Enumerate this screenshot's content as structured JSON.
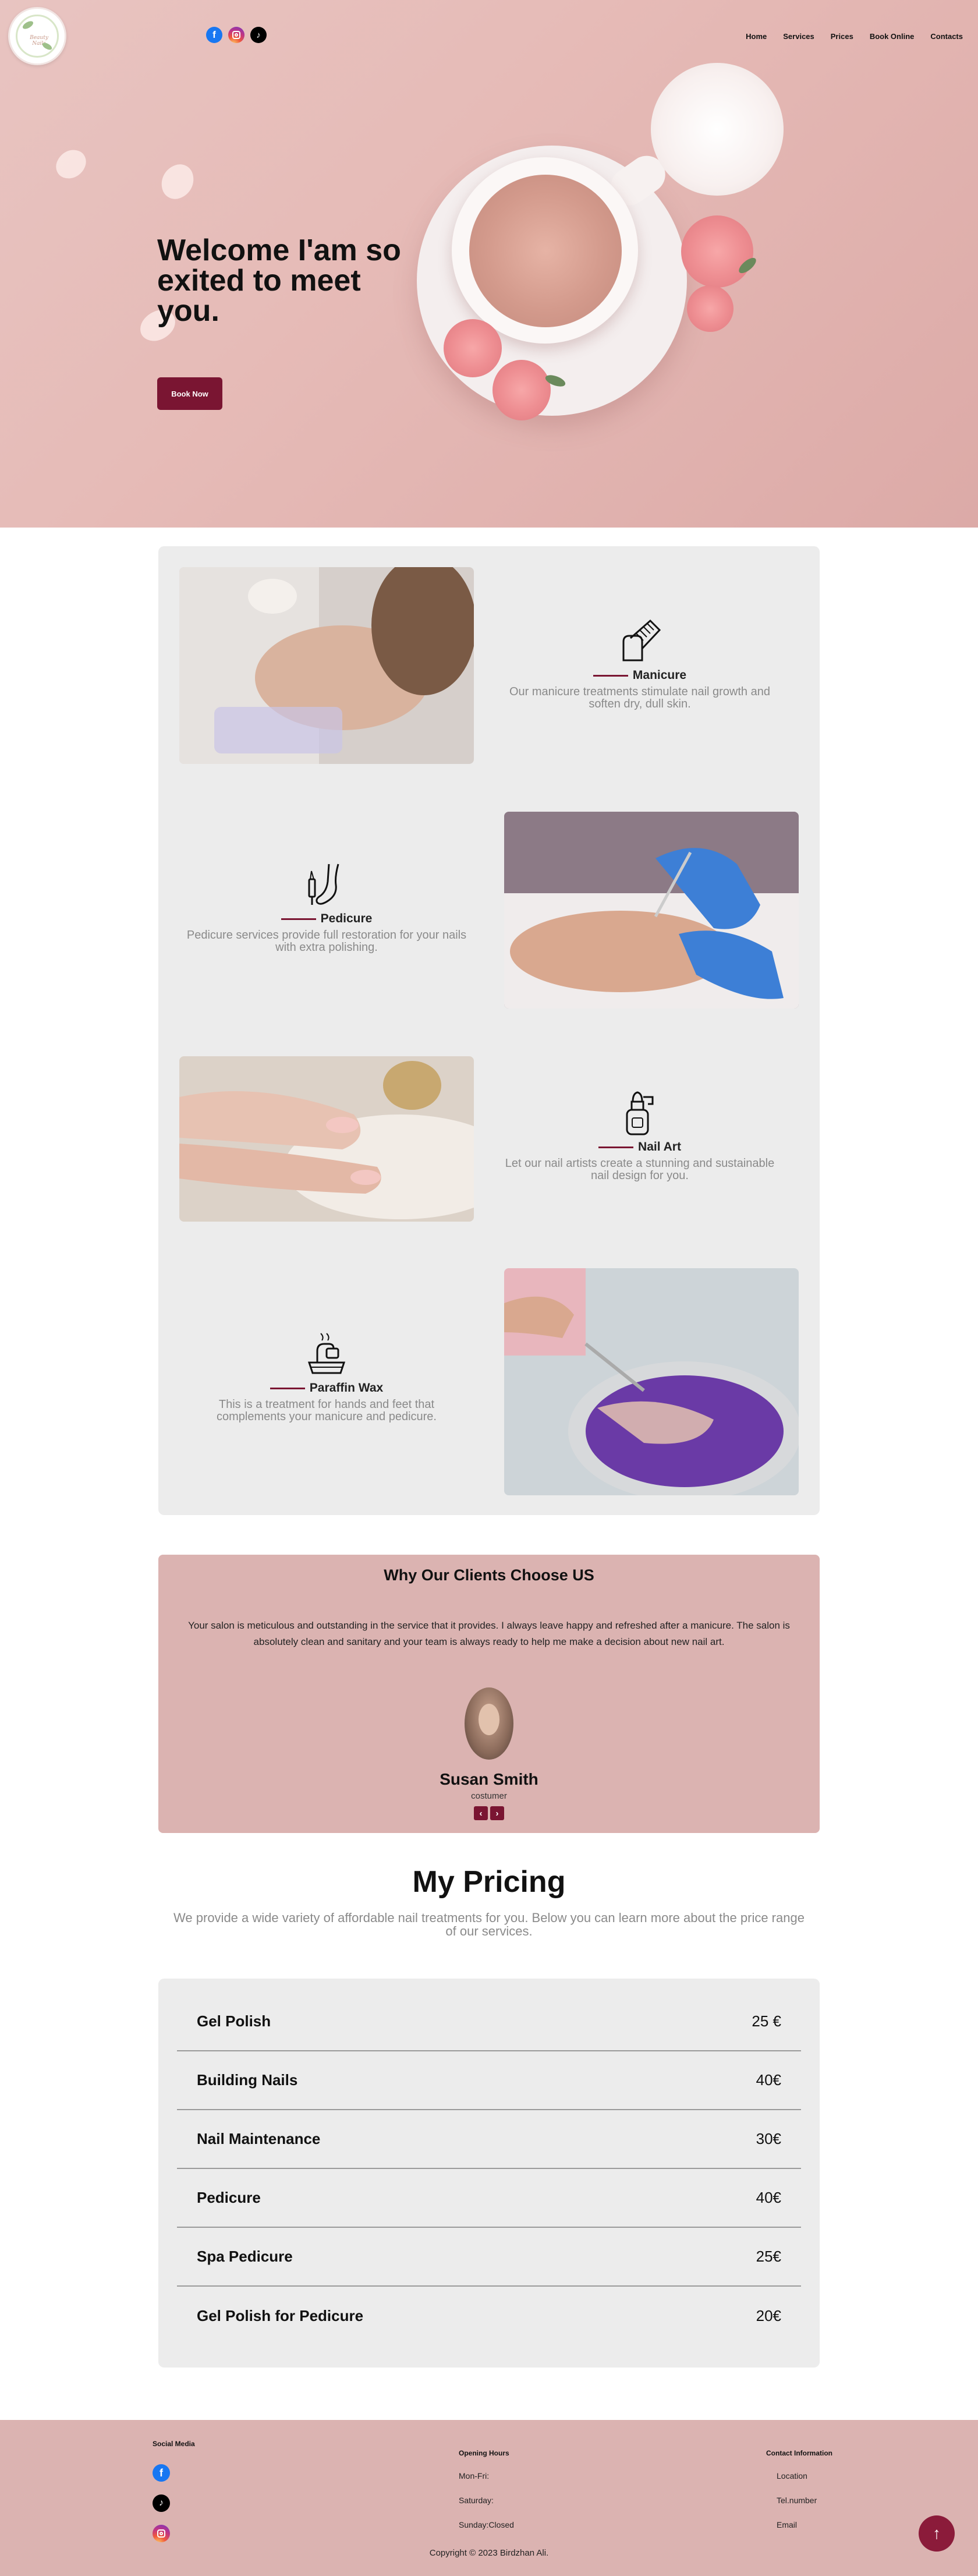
{
  "header": {
    "logo_alt": "Nail salon logo",
    "social": [
      {
        "name": "facebook",
        "icon": "facebook-icon",
        "color": "#1877f2"
      },
      {
        "name": "instagram",
        "icon": "instagram-icon",
        "color": "#c13584"
      },
      {
        "name": "tiktok",
        "icon": "tiktok-icon",
        "color": "#000000"
      }
    ],
    "nav": [
      "Home",
      "Services",
      "Prices",
      "Book Online",
      "Contacts"
    ]
  },
  "hero": {
    "title": "Welcome I'am so exited to meet you.",
    "cta": "Book Now",
    "accent_color": "#7a1532"
  },
  "services": {
    "items": [
      {
        "title": "Manicure",
        "icon": "nail-brush-icon",
        "description": "Our manicure treatments stimulate nail growth and soften dry, dull skin."
      },
      {
        "title": "Pedicure",
        "icon": "foot-icon",
        "description": "Pedicure services provide full restoration for your nails with extra polishing."
      },
      {
        "title": "Nail Art",
        "icon": "nail-polish-icon",
        "description": "Let our nail artists create a stunning and sustainable nail design for you."
      },
      {
        "title": "Paraffin Wax",
        "icon": "wax-bath-icon",
        "description": "This is a treatment for hands and feet that complements your manicure and pedicure."
      }
    ]
  },
  "testimonial": {
    "title": "Why Our Clients Choose US",
    "quote": "Your salon is meticulous and outstanding in the service that it provides. I always leave happy and refreshed after a manicure. The salon is absolutely clean and sanitary and your team is always ready to help me make a decision about new nail art.",
    "name": "Susan Smith",
    "role": "costumer",
    "prev": "‹",
    "next": "›"
  },
  "pricing": {
    "title": "My Pricing",
    "subtitle": "We provide a wide variety of affordable nail treatments for you. Below you can learn more about the price range of our services.",
    "rows": [
      {
        "name": "Gel Polish",
        "price": "25 €"
      },
      {
        "name": "Building Nails",
        "price": "40€"
      },
      {
        "name": "Nail Maintenance",
        "price": "30€"
      },
      {
        "name": "Pedicure",
        "price": "40€"
      },
      {
        "name": "Spa Pedicure",
        "price": "25€"
      },
      {
        "name": "Gel Polish for Pedicure",
        "price": "20€"
      }
    ]
  },
  "footer": {
    "social_title": "Social Media",
    "hours_title": "Opening Hours",
    "hours": [
      "Mon-Fri:",
      "Saturday:",
      "Sunday:Closed"
    ],
    "contact_title": "Contact Information",
    "contact": [
      "Location",
      "Tel.number",
      "Email"
    ],
    "copyright": "Copyright © 2023 Birdzhan Ali.",
    "to_top": "↑",
    "bg_color": "#dbb3b1"
  }
}
